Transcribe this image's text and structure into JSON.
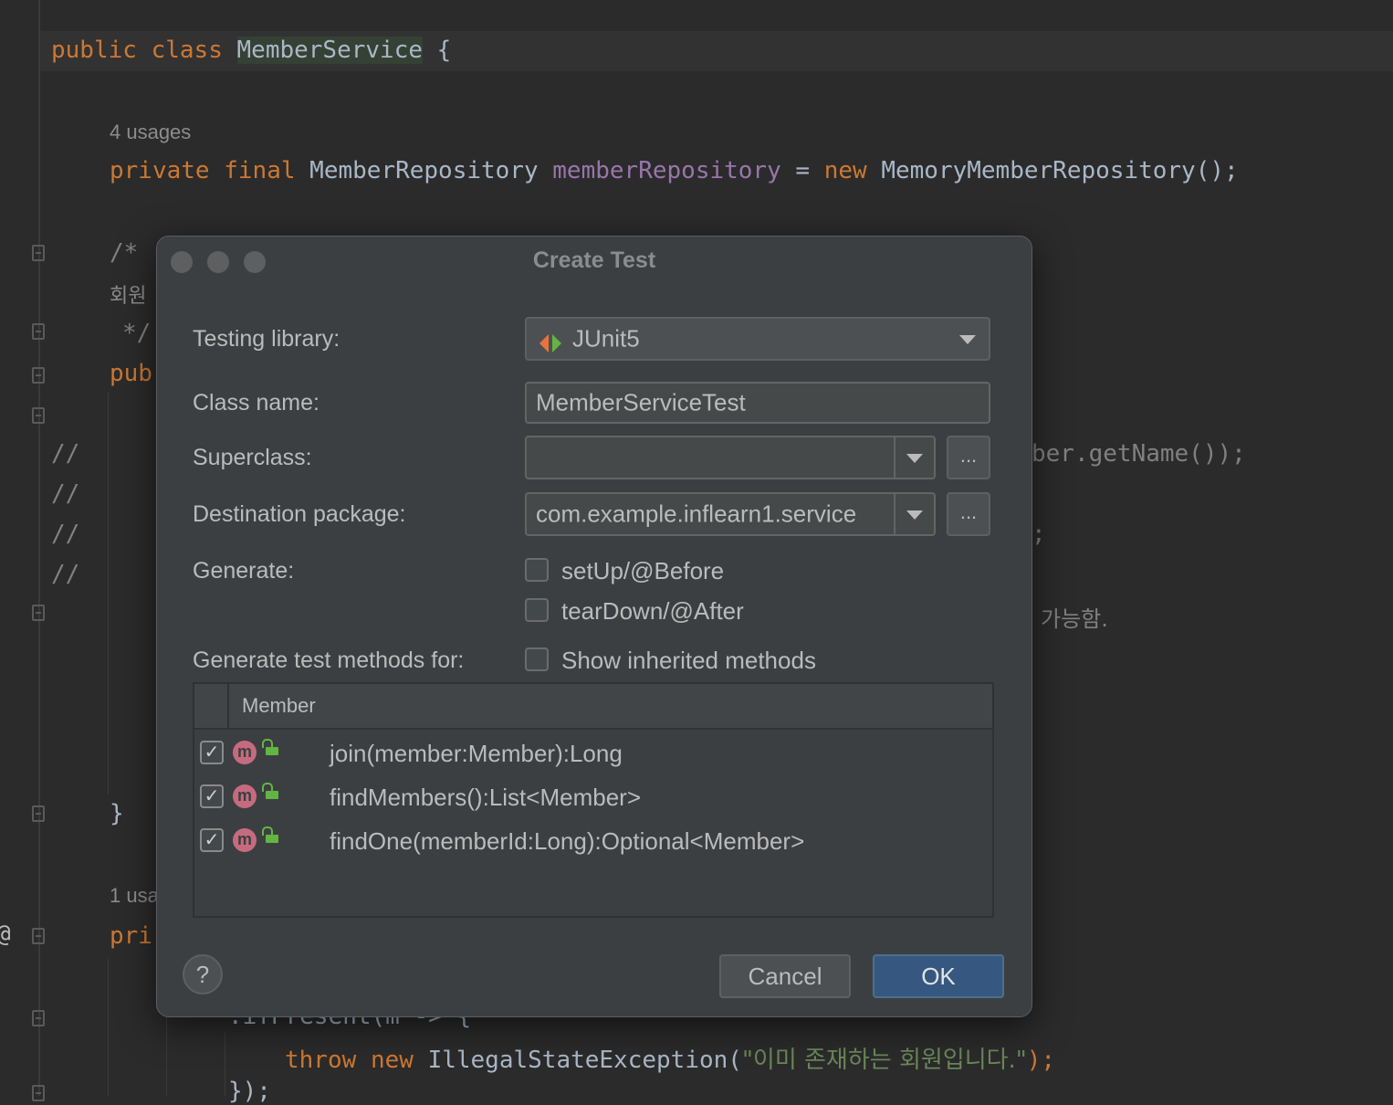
{
  "editor": {
    "line1": {
      "kw1": "public",
      "kw2": "class",
      "name": "MemberService",
      "brace": "{"
    },
    "usage1": "4 usages",
    "line2": {
      "kw1": "private",
      "kw2": "final",
      "type": "MemberRepository",
      "field": "memberRepository",
      "eq": "=",
      "kw3": "new",
      "ctor": "MemoryMemberRepository();"
    },
    "comment_open": "/*",
    "comment_korean": "회원",
    "comment_close": "*/",
    "partial_pub": "pub",
    "slashes": [
      "//",
      "//",
      "//",
      "//"
    ],
    "right_snippet1": "ber.getName());",
    "right_snippet2": ";",
    "right_snippet3": "가능함.",
    "close_brace": "}",
    "usage2": "1 usa",
    "partial_pri": "pri",
    "at_sign": "@",
    "partial_ifpresent": ".ifPresent(m -> {",
    "throw_line": {
      "kw1": "throw",
      "kw2": "new",
      "cls": "IllegalStateException(",
      "str": "\"이미 존재하는 회원입니다.\"",
      "end": ");"
    },
    "last_line": "});"
  },
  "dialog": {
    "title": "Create Test",
    "testing_library": {
      "label": "Testing library:",
      "value": "JUnit5",
      "icon": "junit-icon"
    },
    "class_name": {
      "label": "Class name:",
      "value": "MemberServiceTest"
    },
    "superclass": {
      "label": "Superclass:",
      "value": "",
      "browse": "..."
    },
    "destination_package": {
      "label": "Destination package:",
      "value": "com.example.inflearn1.service",
      "browse": "..."
    },
    "generate": {
      "label": "Generate:",
      "options": [
        {
          "label": "setUp/@Before",
          "checked": false
        },
        {
          "label": "tearDown/@After",
          "checked": false
        }
      ]
    },
    "methods_for": {
      "label": "Generate test methods for:",
      "show_inherited": "Show inherited methods",
      "show_inherited_checked": false
    },
    "table": {
      "header": "Member",
      "rows": [
        {
          "text": "join(member:Member):Long",
          "checked": true,
          "icon": "m"
        },
        {
          "text": "findMembers():List<Member>",
          "checked": true,
          "icon": "m"
        },
        {
          "text": "findOne(memberId:Long):Optional<Member>",
          "checked": true,
          "icon": "m"
        }
      ]
    },
    "help": "?",
    "cancel": "Cancel",
    "ok": "OK",
    "colors": {
      "accent": "#365880",
      "method_icon": "#c66b7f",
      "lock": "#62b543"
    }
  }
}
